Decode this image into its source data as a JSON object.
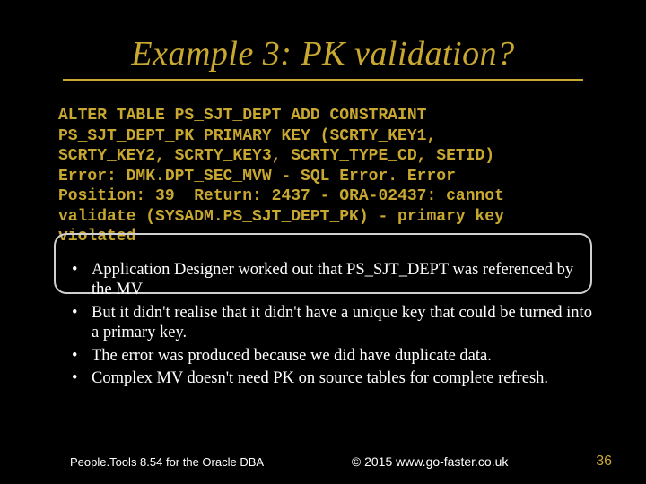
{
  "title": "Example 3: PK validation?",
  "code": {
    "l1": "ALTER TABLE PS_SJT_DEPT ADD CONSTRAINT",
    "l2": "PS_SJT_DEPT_PK PRIMARY KEY (SCRTY_KEY1,",
    "l3": "SCRTY_KEY2, SCRTY_KEY3, SCRTY_TYPE_CD, SETID)",
    "l4": "Error: DMK.DPT_SEC_MVW - SQL Error. Error",
    "l5a": "Position: 39  Return: 2437 - ",
    "l5b": "ORA-02437: cannot",
    "l6": "validate (SYSADM.PS_SJT_DEPT_PK) - primary key",
    "l7": "violated"
  },
  "bullets": [
    "Application Designer worked out that PS_SJT_DEPT was referenced by the MV",
    "But it didn't realise that it didn't have a unique key that could be turned into a primary key.",
    "The error was produced because we did have duplicate data.",
    "Complex MV doesn't need PK on source tables for complete refresh."
  ],
  "footer": {
    "left": "People.Tools 8.54 for the Oracle DBA",
    "center": "© 2015 www.go-faster.co.uk",
    "right": "36"
  }
}
